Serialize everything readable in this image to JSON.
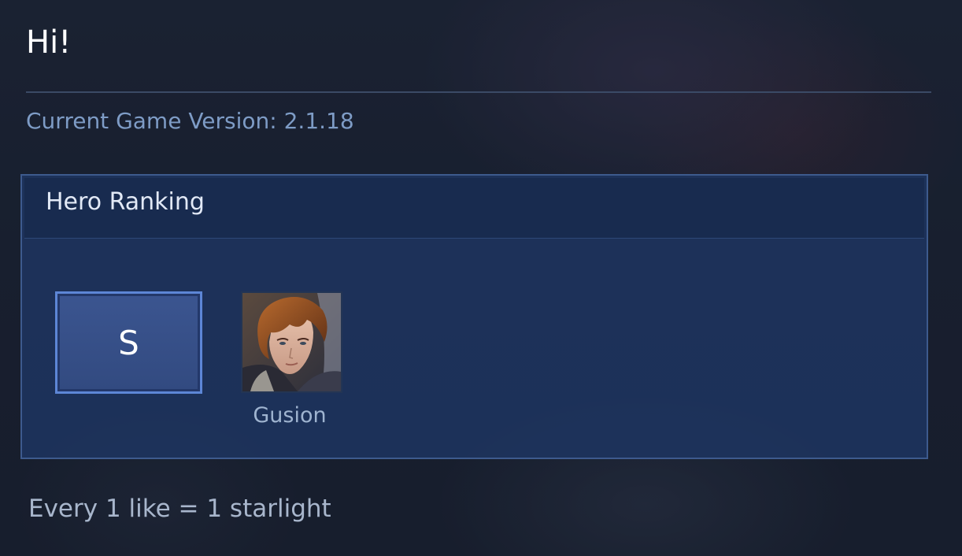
{
  "header": {
    "greeting": "Hi!",
    "version_text": "Current Game Version: 2.1.18"
  },
  "panel": {
    "title": "Hero Ranking",
    "tiers": [
      {
        "label": "S",
        "heroes": [
          {
            "name": "Gusion",
            "icon": "gusion-portrait"
          }
        ]
      }
    ]
  },
  "footer": {
    "text": "Every 1 like = 1 starlight"
  },
  "colors": {
    "accent": "#5d86d6",
    "panel_bg": "#1e3460",
    "muted_text": "#7e9cc6"
  }
}
